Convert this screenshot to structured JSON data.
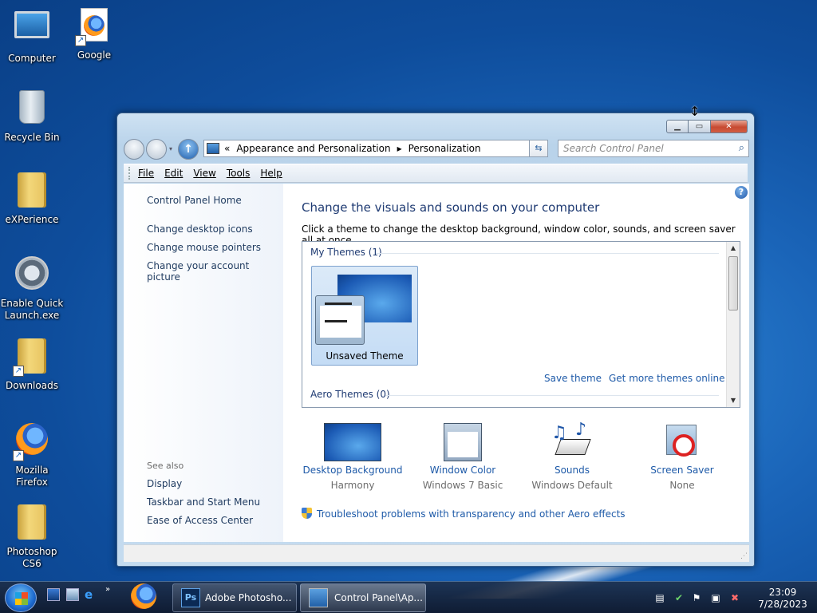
{
  "desktop": {
    "icons": [
      {
        "label": "Computer",
        "icon": "computer-icon"
      },
      {
        "label": "Google",
        "icon": "firefox-shortcut-icon"
      },
      {
        "label": "Recycle Bin",
        "icon": "recycle-bin-icon"
      },
      {
        "label": "eXPerience",
        "icon": "folder-icon"
      },
      {
        "label": "Enable Quick Launch.exe",
        "icon": "app-icon"
      },
      {
        "label": "Downloads",
        "icon": "folder-shortcut-icon"
      },
      {
        "label": "Mozilla Firefox",
        "icon": "firefox-icon"
      },
      {
        "label": "Photoshop CS6",
        "icon": "folder-icon"
      }
    ]
  },
  "window": {
    "breadcrumb": {
      "sep": "«",
      "parts": [
        "Appearance and Personalization",
        "Personalization"
      ],
      "arrow": "▸"
    },
    "search_placeholder": "Search Control Panel",
    "menu": [
      "File",
      "Edit",
      "View",
      "Tools",
      "Help"
    ],
    "left_pane": {
      "home": "Control Panel Home",
      "links": [
        "Change desktop icons",
        "Change mouse pointers",
        "Change your account picture"
      ],
      "see_also_heading": "See also",
      "see_also": [
        "Display",
        "Taskbar and Start Menu",
        "Ease of Access Center"
      ]
    },
    "main": {
      "heading": "Change the visuals and sounds on your computer",
      "subheading": "Click a theme to change the desktop background, window color, sounds, and screen saver all at once.",
      "my_themes_label": "My Themes (1)",
      "theme_name": "Unsaved Theme",
      "save_theme": "Save theme",
      "get_more": "Get more themes online",
      "aero_themes_label": "Aero Themes (0)",
      "bottom_items": [
        {
          "title": "Desktop Background",
          "value": "Harmony"
        },
        {
          "title": "Window Color",
          "value": "Windows 7 Basic"
        },
        {
          "title": "Sounds",
          "value": "Windows Default"
        },
        {
          "title": "Screen Saver",
          "value": "None"
        }
      ],
      "troubleshoot": "Troubleshoot problems with transparency and other Aero effects"
    }
  },
  "taskbar": {
    "buttons": [
      {
        "label": "Adobe Photosho...",
        "icon": "photoshop-icon"
      },
      {
        "label": "Control Panel\\Ap...",
        "icon": "control-panel-icon"
      }
    ],
    "clock_time": "23:09",
    "clock_date": "7/28/2023"
  },
  "colors": {
    "link": "#1e5aa8",
    "heading": "#1e3a72"
  }
}
